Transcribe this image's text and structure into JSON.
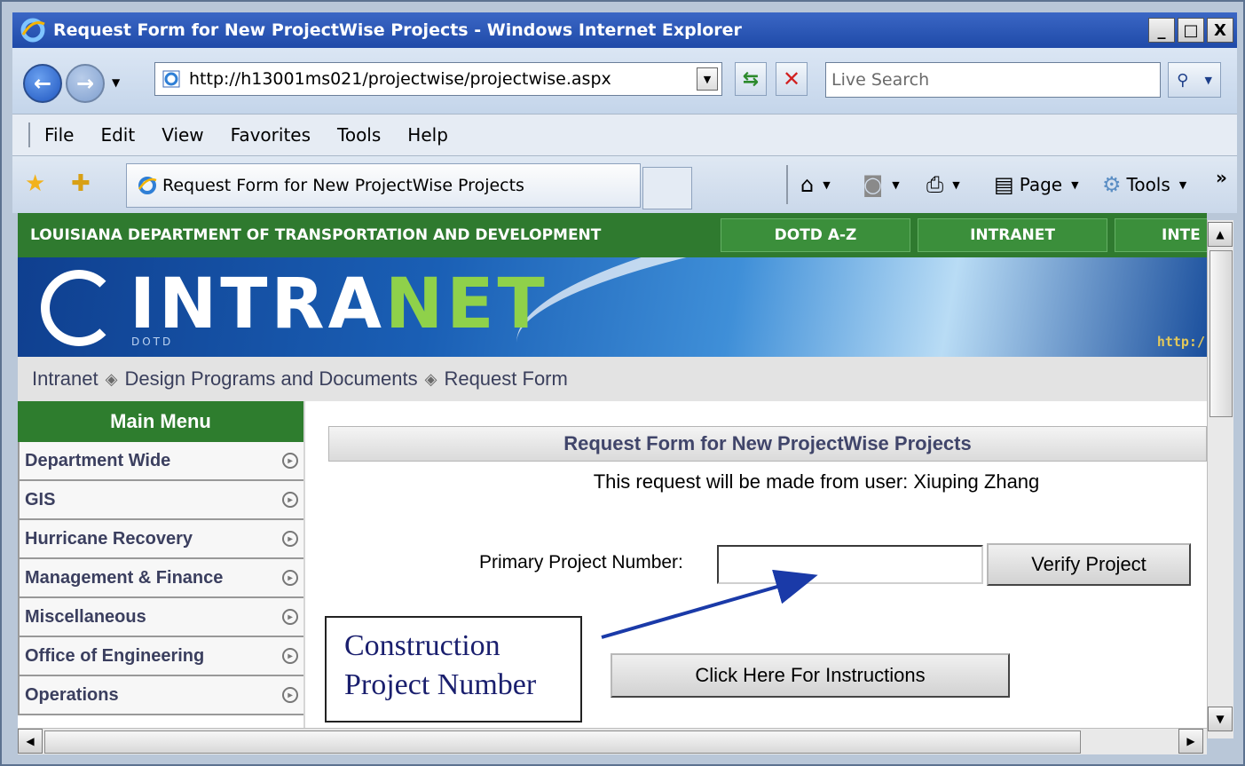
{
  "window": {
    "title": "Request Form for New ProjectWise Projects - Windows Internet Explorer",
    "controls": [
      "_",
      "□",
      "X"
    ]
  },
  "navbar": {
    "address": "http://h13001ms021/projectwise/projectwise.aspx",
    "search_placeholder": "Live Search"
  },
  "menubar": {
    "items": [
      "File",
      "Edit",
      "View",
      "Favorites",
      "Tools",
      "Help"
    ]
  },
  "tabbar": {
    "tab_title": "Request Form for New ProjectWise Projects",
    "page_label": "Page",
    "tools_label": "Tools"
  },
  "site": {
    "department": "LOUISIANA DEPARTMENT OF TRANSPORTATION AND DEVELOPMENT",
    "topnav": [
      "DOTD A-Z",
      "INTRANET",
      "INTE"
    ],
    "logo_text_a": "INTRA",
    "logo_text_b": "NET",
    "logo_sub": "DOTD",
    "banner_url": "http:/"
  },
  "breadcrumb": [
    "Intranet",
    "Design Programs and Documents",
    "Request Form"
  ],
  "main_menu": {
    "title": "Main Menu",
    "items": [
      "Department Wide",
      "GIS",
      "Hurricane Recovery",
      "Management & Finance",
      "Miscellaneous",
      "Office of Engineering",
      "Operations"
    ]
  },
  "form": {
    "heading": "Request Form for New ProjectWise Projects",
    "user_line": "This request will be made from user: Xiuping Zhang",
    "project_label": "Primary Project Number:",
    "project_value": "",
    "verify_label": "Verify Project",
    "instructions_label": "Click Here For Instructions"
  },
  "callout": {
    "line1": "Construction",
    "line2": "Project Number"
  },
  "colors": {
    "site_green": "#2f7a2f",
    "titlebar_blue": "#2453b3",
    "callout_text": "#1a1f6e"
  }
}
